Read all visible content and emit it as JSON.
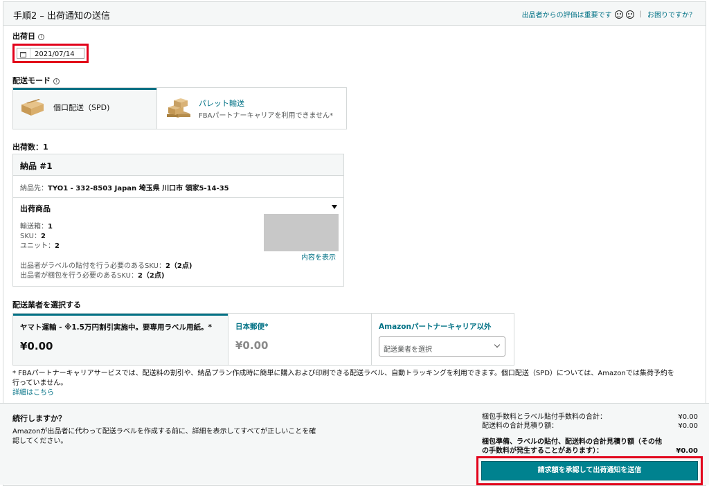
{
  "header": {
    "title": "手順2 – 出荷通知の送信",
    "feedback_link": "出品者からの評価は重要です",
    "separator": "|",
    "help_link": "お困りですか？"
  },
  "ship_date": {
    "label": "出荷日",
    "value": "2021/07/14"
  },
  "shipping_mode": {
    "label": "配送モード",
    "spd": {
      "label": "個口配送（SPD)"
    },
    "pallet": {
      "label": "パレット輸送",
      "sub": "FBAパートナーキャリアを利用できません*"
    }
  },
  "shipments": {
    "count_label": "出荷数：1",
    "shipment_title": "納品 #1",
    "destination_label": "納品先：",
    "destination_value": "TYO1 - 332-8503 Japan 埼玉県 川口市 領家5-14-35",
    "items_label": "出荷商品",
    "boxes_label": "輸送箱：",
    "boxes_value": "1",
    "sku_label": "SKU：",
    "sku_value": "2",
    "units_label": "ユニット：",
    "units_value": "2",
    "show_contents": "内容を表示",
    "label_sku_text": "出品者がラベルの貼付を行う必要のあるSKU：",
    "label_sku_value": "2（2点)",
    "prep_sku_text": "出品者が梱包を行う必要のあるSKU：",
    "prep_sku_value": "2（2点)"
  },
  "carrier": {
    "label": "配送業者を選択する",
    "yamato": {
      "name": "ヤマト運輸 - ※1.5万円割引実施中。要専用ラベル用紙。*",
      "price": "¥0.00"
    },
    "japanpost": {
      "name": "日本郵便*",
      "price": "¥0.00"
    },
    "other": {
      "name": "Amazonパートナーキャリア以外",
      "select_placeholder": "配送業者を選択"
    }
  },
  "note": {
    "text1": "* FBAパートナーキャリアサービスでは、配送料の割引や、納品プラン作成時に簡単に購入および印刷できる配送ラベル、自動トラッキングを利用できます。個口配送（SPD）については、Amazonでは集荷予約を",
    "text2": "行っていません。",
    "link": "詳細はこちら"
  },
  "footer": {
    "continue_title": "続行しますか？",
    "continue_desc1": "Amazonが出品者に代わって配送ラベルを作成する前に、詳細を表示してすべてが正しいことを確",
    "continue_desc2": "認してください。",
    "fee_label": "梱包手数料とラベル貼付手数料の合計：",
    "fee_value": "¥0.00",
    "shipping_label": "配送料の合計見積り額：",
    "shipping_value": "¥0.00",
    "total_label1": "梱包準備、ラベルの貼付、配送料の合計見積り額（その他",
    "total_label2": "の手数料が発生することがあります）：",
    "total_value": "¥0.00",
    "submit_button": "請求額を承認して出荷通知を送信"
  },
  "colors": {
    "accent": "#007185",
    "button": "#00828f",
    "highlight": "#e2001a"
  }
}
